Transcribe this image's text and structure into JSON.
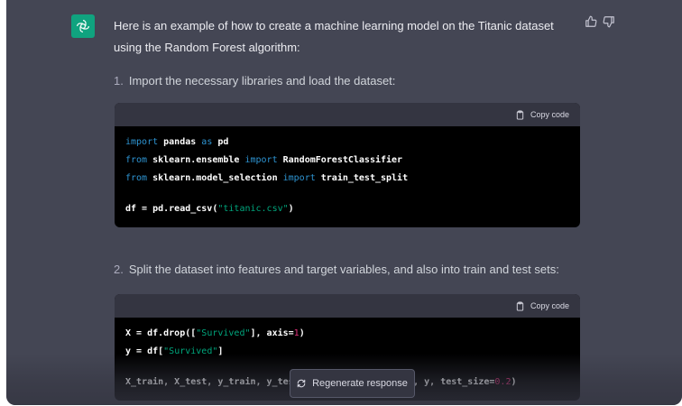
{
  "assistant": {
    "logo_icon": "openai-logo-icon",
    "accent_color": "#10a37f"
  },
  "feedback": {
    "thumbs_up_icon": "thumbs-up-icon",
    "thumbs_down_icon": "thumbs-down-icon"
  },
  "message": {
    "intro": "Here is an example of how to create a machine learning model on the Titanic dataset using the Random Forest algorithm:",
    "steps": [
      {
        "number": "1.",
        "text": "Import the necessary libraries and load the dataset:"
      },
      {
        "number": "2.",
        "text": "Split the dataset into features and target variables, and also into train and test sets:"
      }
    ]
  },
  "code_blocks": [
    {
      "copy_label": "Copy code",
      "lines": [
        [
          {
            "t": "import",
            "c": "kw"
          },
          {
            "t": " pandas "
          },
          {
            "t": "as",
            "c": "kw"
          },
          {
            "t": " pd"
          }
        ],
        [
          {
            "t": "from",
            "c": "kw"
          },
          {
            "t": " sklearn.ensemble "
          },
          {
            "t": "import",
            "c": "kw"
          },
          {
            "t": " RandomForestClassifier"
          }
        ],
        [
          {
            "t": "from",
            "c": "kw"
          },
          {
            "t": " sklearn.model_selection "
          },
          {
            "t": "import",
            "c": "kw"
          },
          {
            "t": " train_test_split"
          }
        ],
        [],
        [
          {
            "t": "df = pd.read_csv("
          },
          {
            "t": "\"titanic.csv\"",
            "c": "str"
          },
          {
            "t": ")"
          }
        ]
      ]
    },
    {
      "copy_label": "Copy code",
      "lines": [
        [
          {
            "t": "X = df.drop(["
          },
          {
            "t": "\"Survived\"",
            "c": "str"
          },
          {
            "t": "], axis="
          },
          {
            "t": "1",
            "c": "num-lit"
          },
          {
            "t": ")"
          }
        ],
        [
          {
            "t": "y = df["
          },
          {
            "t": "\"Survived\"",
            "c": "str"
          },
          {
            "t": "]"
          }
        ],
        [],
        [
          {
            "t": "X_train, X_test, y_train, y_test = train_test_split(X, y, test_size="
          },
          {
            "t": "0.2",
            "c": "num-lit"
          },
          {
            "t": ")"
          }
        ]
      ]
    }
  ],
  "regenerate": {
    "label": "Regenerate response",
    "icon": "refresh-icon"
  }
}
